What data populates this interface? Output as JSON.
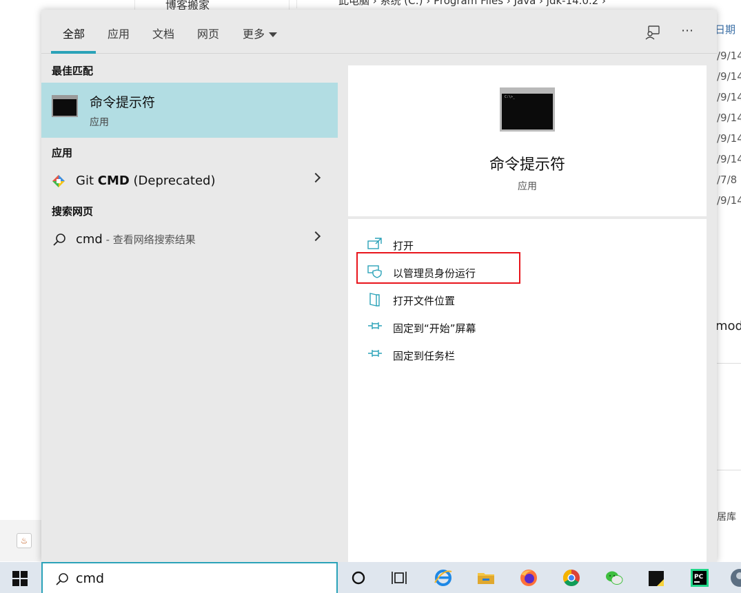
{
  "background": {
    "blog_label": "博客搬家",
    "breadcrumb": "此电脑  ›  系统 (C:)  ›  Program Files  ›  Java  ›  jdk-14.0.2  ›",
    "date_header": "日期",
    "dates": [
      "/9/14",
      "/9/14",
      "/9/14",
      "/9/14",
      "/9/14",
      "/9/14",
      "/7/8",
      "/9/14"
    ],
    "mod_label": "mod",
    "ku_label": "居库"
  },
  "tabs": [
    {
      "label": "全部"
    },
    {
      "label": "应用"
    },
    {
      "label": "文档"
    },
    {
      "label": "网页"
    },
    {
      "label": "更多"
    }
  ],
  "icons": {
    "feedback": "feedback-icon",
    "more": "more-icon",
    "more_glyph": "⋯"
  },
  "left": {
    "best_match_header": "最佳匹配",
    "best_match": {
      "title": "命令提示符",
      "subtitle": "应用"
    },
    "apps_header": "应用",
    "git_cmd": {
      "prefix": "Git ",
      "bold": "CMD",
      "suffix": " (Deprecated)"
    },
    "web_header": "搜索网页",
    "web_search": {
      "query": "cmd",
      "hint": " - 查看网络搜索结果"
    }
  },
  "right": {
    "title": "命令提示符",
    "subtitle": "应用",
    "thumb_prompt": "C:\\>_",
    "actions": [
      {
        "label": "打开",
        "icon": "open-icon"
      },
      {
        "label": "以管理员身份运行",
        "icon": "shield-icon"
      },
      {
        "label": "打开文件位置",
        "icon": "file-location-icon"
      },
      {
        "label": "固定到“开始”屏幕",
        "icon": "pin-icon"
      },
      {
        "label": "固定到任务栏",
        "icon": "pin-icon"
      }
    ],
    "highlight_color": "#e8141b"
  },
  "taskbar": {
    "search_value": "cmd",
    "apps": [
      "cortana-icon",
      "task-view-icon",
      "ie-icon",
      "file-explorer-icon",
      "firefox-icon",
      "chrome-icon",
      "wechat-icon",
      "sticky-notes-icon",
      "pycharm-icon",
      "avatar-icon"
    ],
    "pycharm_text": "PC"
  },
  "colors": {
    "accent": "#2aa2b8",
    "selection": "#b2dde3",
    "panel_bg": "#e9e9e9",
    "taskbar_bg": "#dfe6ee"
  }
}
